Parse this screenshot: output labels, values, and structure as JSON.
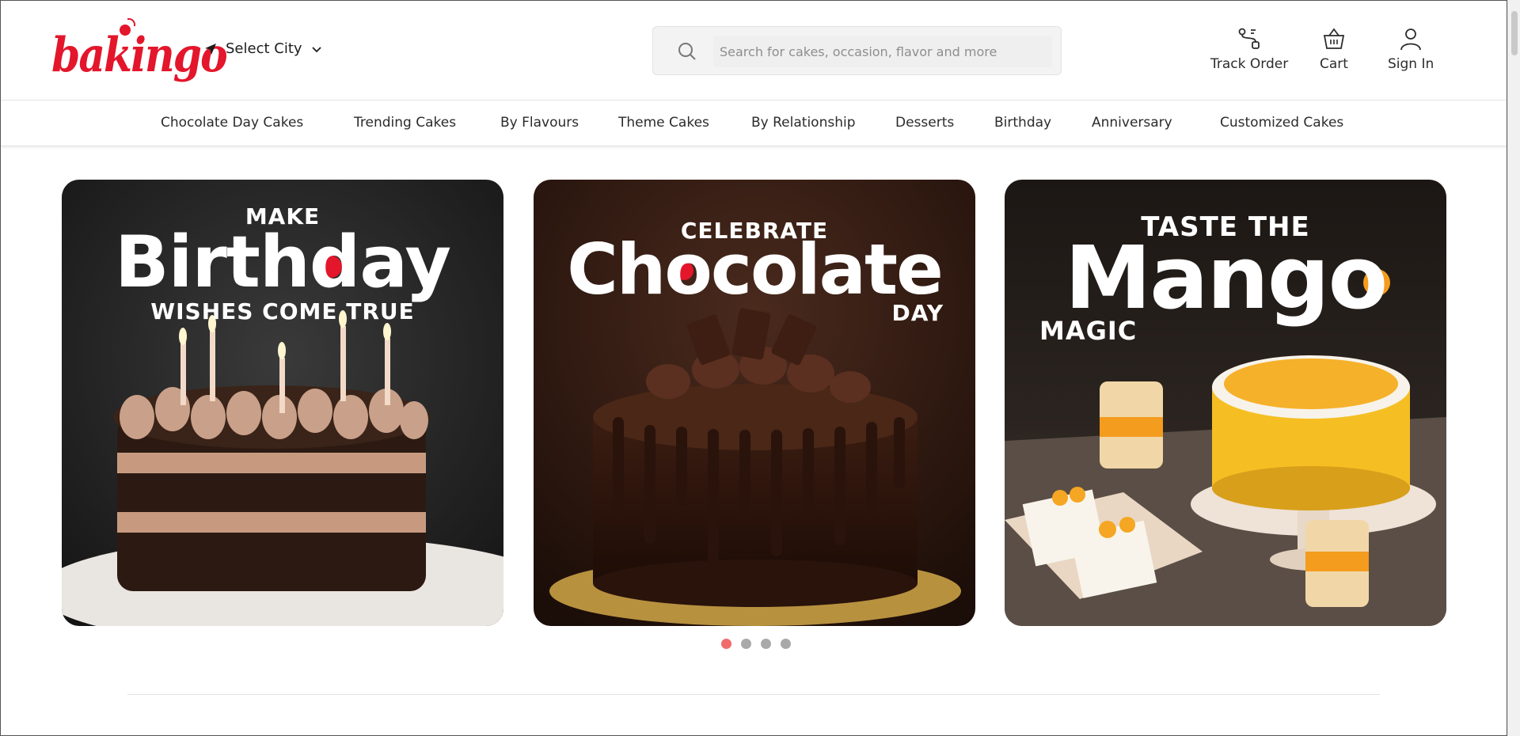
{
  "brand": {
    "logo_text": "bakingo",
    "accent": "#e3162b"
  },
  "header": {
    "city_label": "Select City",
    "search_placeholder": "Search for cakes, occasion, flavor and more",
    "actions": [
      {
        "label": "Track Order",
        "icon": "track-order-icon"
      },
      {
        "label": "Cart",
        "icon": "cart-basket-icon"
      },
      {
        "label": "Sign In",
        "icon": "user-icon"
      }
    ]
  },
  "nav": {
    "items": [
      "Chocolate Day Cakes",
      "Trending Cakes",
      "By Flavours",
      "Theme Cakes",
      "By Relationship",
      "Desserts",
      "Birthday",
      "Anniversary",
      "Customized Cakes"
    ]
  },
  "banners": [
    {
      "top": "MAKE",
      "title": "Birthday",
      "bottom": "WISHES COME TRUE",
      "image": "layered chocolate birthday cake with candles"
    },
    {
      "top": "CELEBRATE",
      "title": "Chocolate",
      "bottom": "DAY",
      "image": "chocolate drip cake"
    },
    {
      "top": "TASTE THE",
      "title": "Mango",
      "bottom": "MAGIC",
      "image": "mango cake with jars and pastries"
    }
  ],
  "carousel": {
    "dots": 4,
    "active_index": 0,
    "active_color": "#f06c6c",
    "inactive_color": "#a9a9a9"
  }
}
